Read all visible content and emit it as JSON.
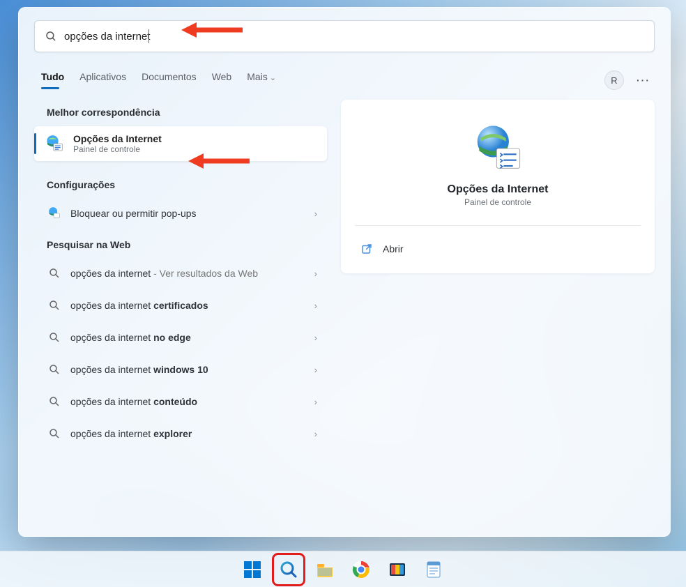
{
  "search": {
    "value": "opções da internet",
    "placeholder": ""
  },
  "tabs": {
    "items": [
      "Tudo",
      "Aplicativos",
      "Documentos",
      "Web",
      "Mais"
    ],
    "active_index": 0
  },
  "user": {
    "initial": "R"
  },
  "sections": {
    "best_match": "Melhor correspondência",
    "settings": "Configurações",
    "search_web": "Pesquisar na Web"
  },
  "best_match": {
    "title": "Opções da Internet",
    "subtitle": "Painel de controle"
  },
  "settings_items": [
    {
      "label": "Bloquear ou permitir pop-ups"
    }
  ],
  "web_items": [
    {
      "prefix": "opções da internet",
      "suffix": " - Ver resultados da Web",
      "suffix_style": "grey"
    },
    {
      "prefix": "opções da internet ",
      "suffix": "certificados",
      "suffix_style": "bold"
    },
    {
      "prefix": "opções da internet ",
      "suffix": "no edge",
      "suffix_style": "bold"
    },
    {
      "prefix": "opções da internet ",
      "suffix": "windows 10",
      "suffix_style": "bold"
    },
    {
      "prefix": "opções da internet ",
      "suffix": "conteúdo",
      "suffix_style": "bold"
    },
    {
      "prefix": "opções da internet ",
      "suffix": "explorer",
      "suffix_style": "bold"
    }
  ],
  "preview": {
    "title": "Opções da Internet",
    "subtitle": "Painel de controle",
    "actions": [
      {
        "label": "Abrir",
        "icon": "open-external-icon"
      }
    ]
  },
  "taskbar": {
    "items": [
      "start",
      "search",
      "file-explorer",
      "chrome",
      "photos",
      "notepad"
    ],
    "highlighted_index": 1
  }
}
